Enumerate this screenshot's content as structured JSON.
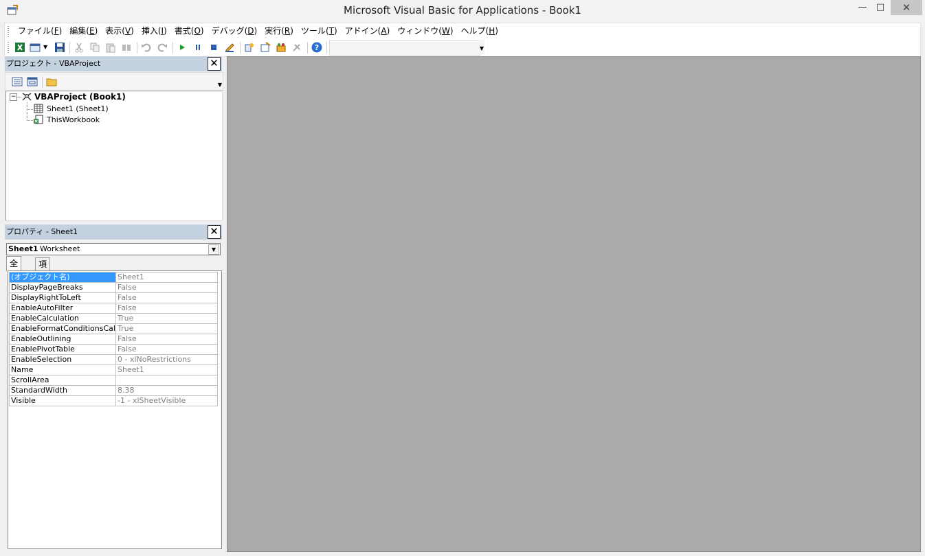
{
  "window": {
    "title": "Microsoft Visual Basic for Applications - Book1"
  },
  "menu": [
    {
      "label": "ファイル(",
      "key": "F",
      "tail": ")"
    },
    {
      "label": "編集(",
      "key": "E",
      "tail": ")"
    },
    {
      "label": "表示(",
      "key": "V",
      "tail": ")"
    },
    {
      "label": "挿入(",
      "key": "I",
      "tail": ")"
    },
    {
      "label": "書式(",
      "key": "O",
      "tail": ")"
    },
    {
      "label": "デバッグ(",
      "key": "D",
      "tail": ")"
    },
    {
      "label": "実行(",
      "key": "R",
      "tail": ")"
    },
    {
      "label": "ツール(",
      "key": "T",
      "tail": ")"
    },
    {
      "label": "アドイン(",
      "key": "A",
      "tail": ")"
    },
    {
      "label": "ウィンドウ(",
      "key": "W",
      "tail": ")"
    },
    {
      "label": "ヘルプ(",
      "key": "H",
      "tail": ")"
    }
  ],
  "project_panel": {
    "title": "プロジェクト - VBAProject",
    "tree": {
      "root": "VBAProject (Book1)",
      "children": [
        "Sheet1 (Sheet1)",
        "ThisWorkbook"
      ]
    }
  },
  "properties_panel": {
    "title": "プロパティ - Sheet1",
    "object_name": "Sheet1",
    "object_type": "Worksheet",
    "tabs": [
      "全体",
      "項目別"
    ],
    "rows": [
      {
        "key": "(オブジェクト名)",
        "value": "Sheet1"
      },
      {
        "key": "DisplayPageBreaks",
        "value": "False"
      },
      {
        "key": "DisplayRightToLeft",
        "value": "False"
      },
      {
        "key": "EnableAutoFilter",
        "value": "False"
      },
      {
        "key": "EnableCalculation",
        "value": "True"
      },
      {
        "key": "EnableFormatConditionsCalcu",
        "value": "True"
      },
      {
        "key": "EnableOutlining",
        "value": "False"
      },
      {
        "key": "EnablePivotTable",
        "value": "False"
      },
      {
        "key": "EnableSelection",
        "value": "0 - xlNoRestrictions"
      },
      {
        "key": "Name",
        "value": "Sheet1"
      },
      {
        "key": "ScrollArea",
        "value": ""
      },
      {
        "key": "StandardWidth",
        "value": "8.38"
      },
      {
        "key": "Visible",
        "value": "-1 - xlSheetVisible"
      }
    ]
  },
  "colors": {
    "panel_header": "#c4d1df",
    "mdi_background": "#ababab",
    "selection": "#3399ff"
  }
}
